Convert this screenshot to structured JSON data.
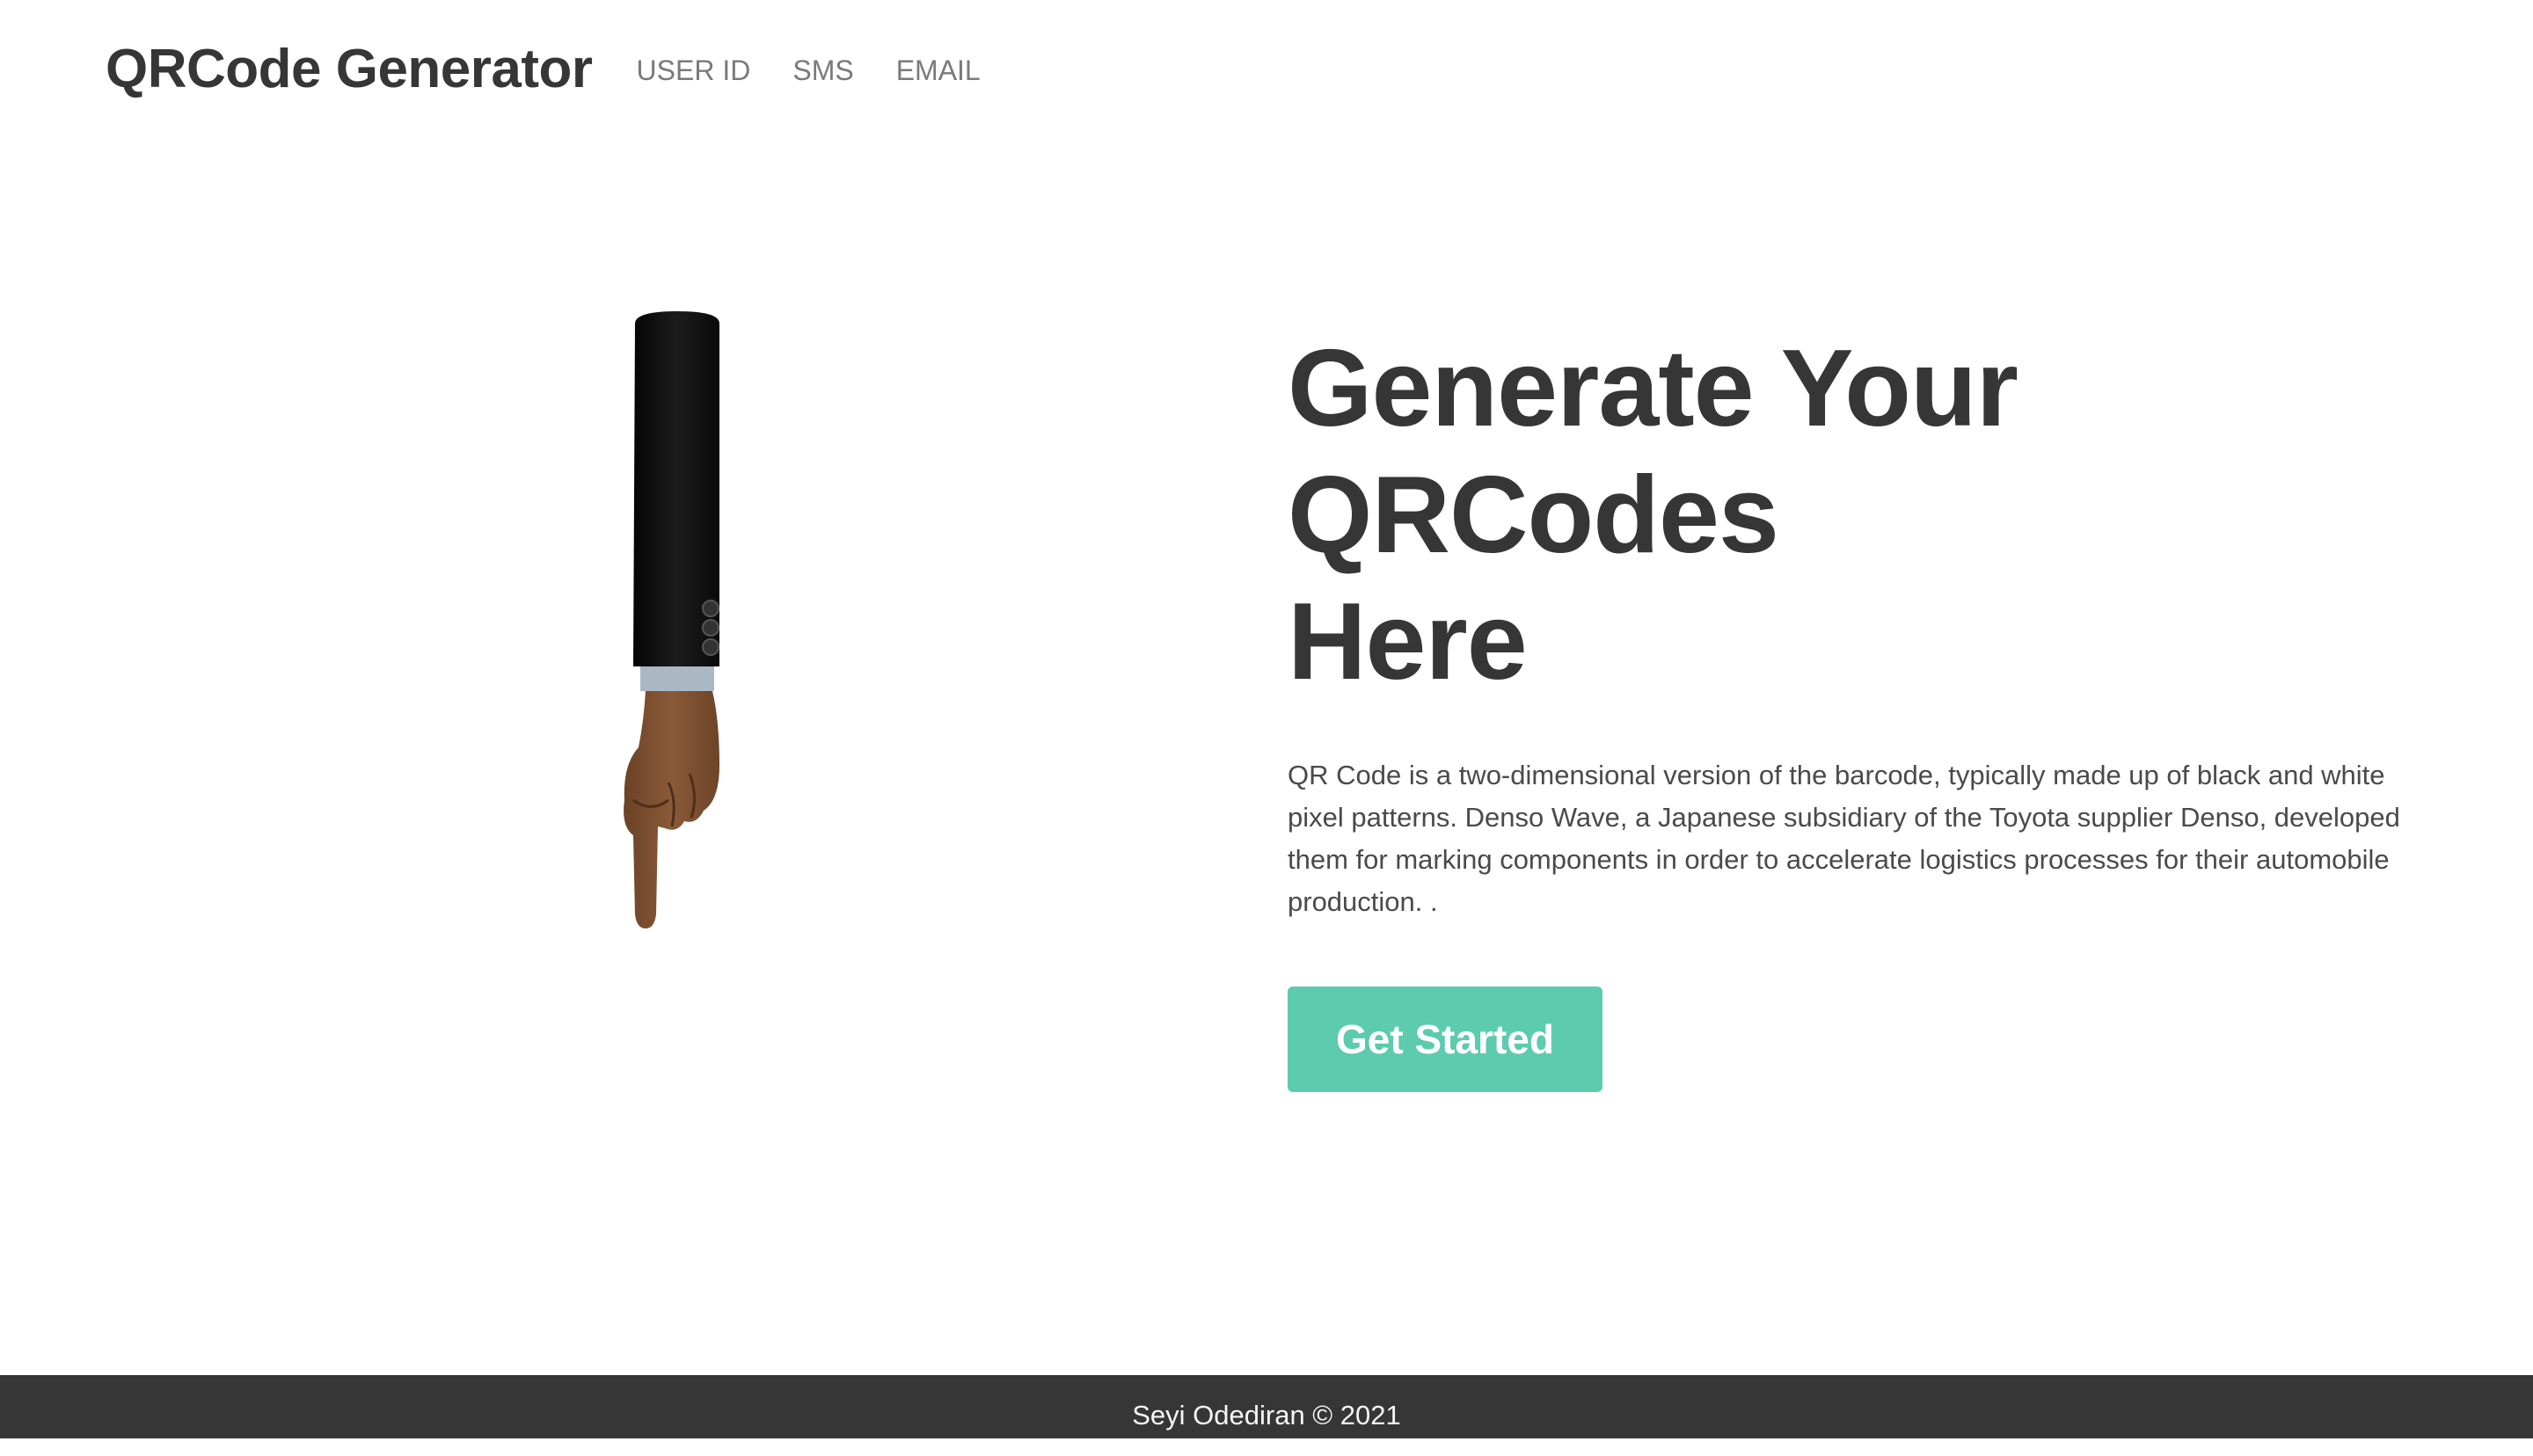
{
  "navbar": {
    "brand": "QRCode Generator",
    "links": [
      "USER ID",
      "SMS",
      "EMAIL"
    ]
  },
  "hero": {
    "title_lines": [
      "Generate Your",
      "QRCodes",
      "Here"
    ],
    "description": "QR Code is a two-dimensional version of the barcode, typically made up of black and white pixel patterns. Denso Wave, a Japanese subsidiary of the Toyota supplier Denso, developed them for marking components in order to accelerate logistics processes for their automobile production. .",
    "cta_label": "Get Started",
    "illustration": "pointing-hand-down-icon"
  },
  "footer": {
    "text": "Seyi Odediran © 2021"
  },
  "colors": {
    "accent": "#5ccbae",
    "text_dark": "#363636",
    "nav_text": "#7a7a7a",
    "footer_bg": "#363636"
  }
}
